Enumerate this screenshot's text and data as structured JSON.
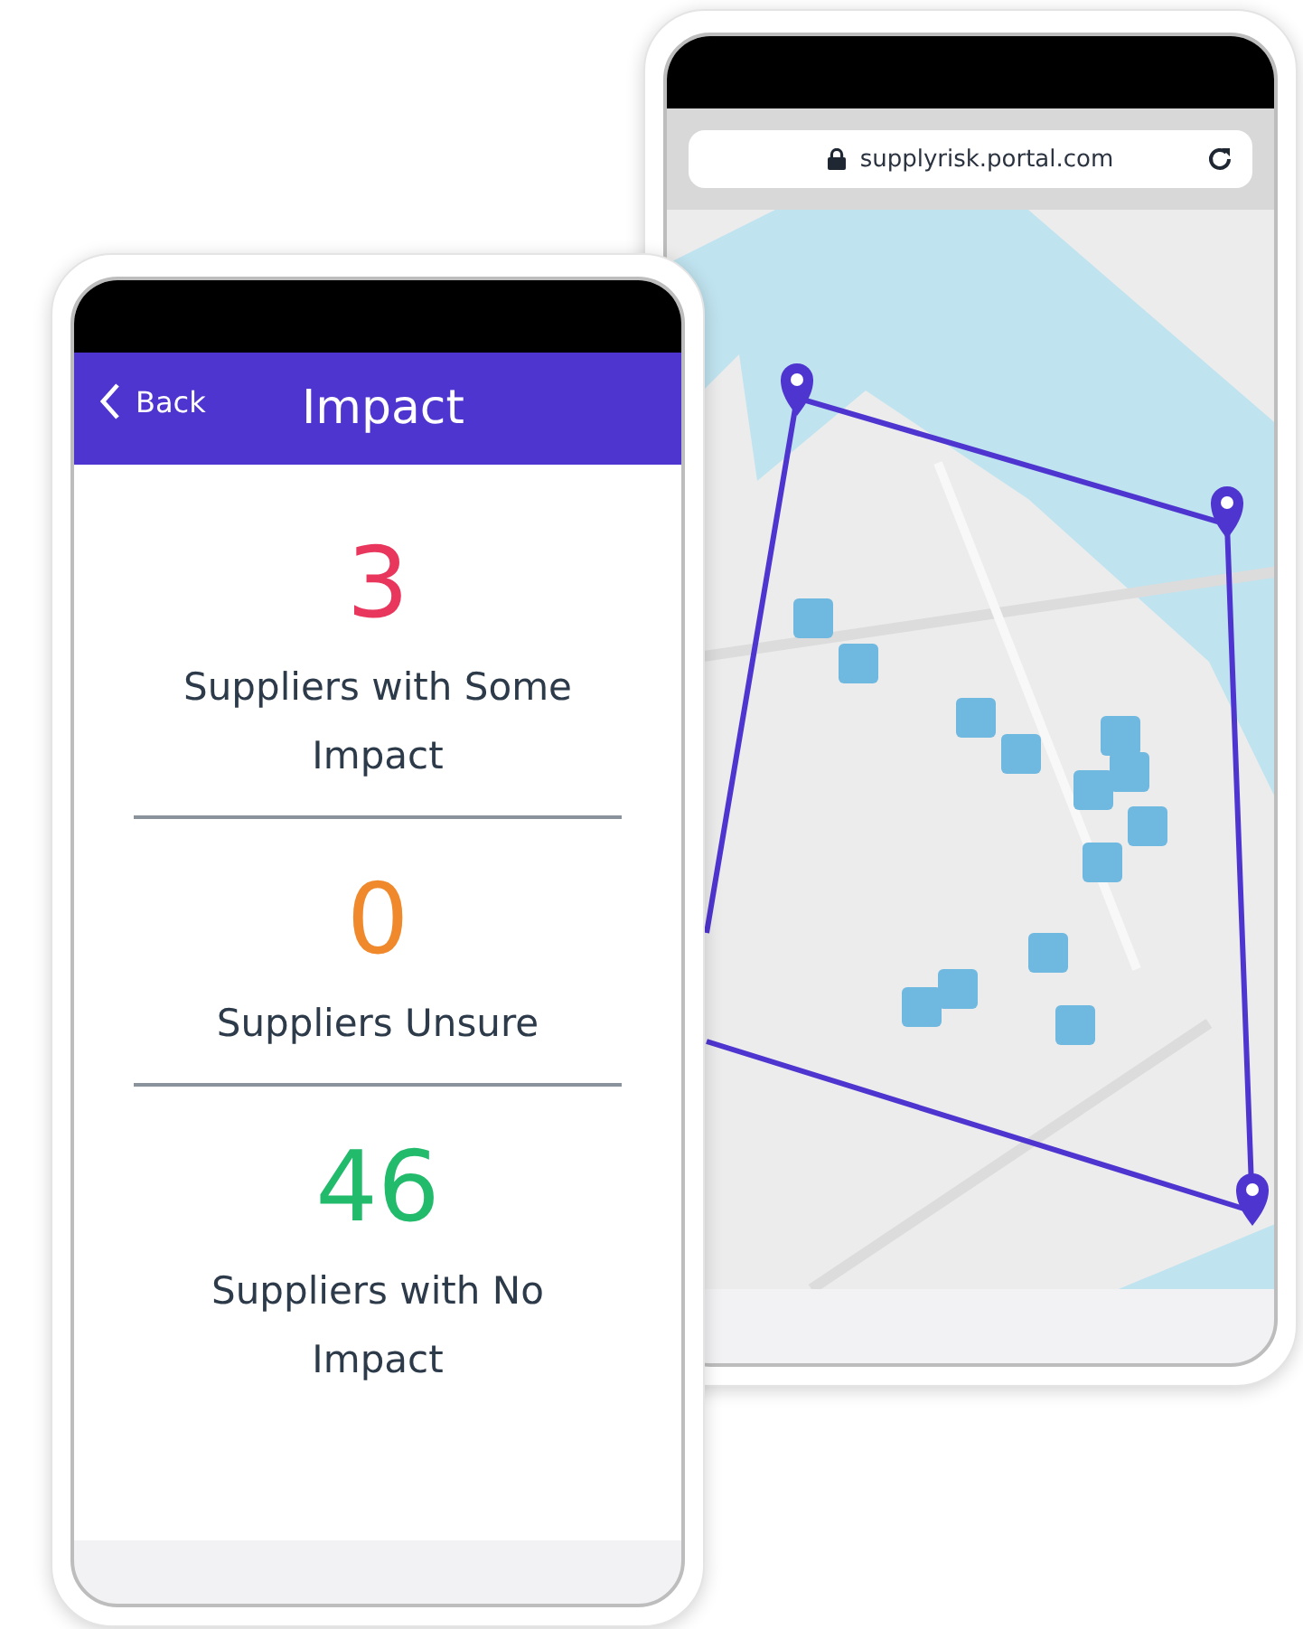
{
  "map_phone": {
    "address_bar": {
      "url": "supplyrisk.portal.com"
    }
  },
  "impact_phone": {
    "header": {
      "back_label": "Back",
      "title": "Impact"
    },
    "stats": [
      {
        "value": "3",
        "label": "Suppliers with Some Impact",
        "color": "#e8365c"
      },
      {
        "value": "0",
        "label": "Suppliers Unsure",
        "color": "#f0892c"
      },
      {
        "value": "46",
        "label": "Suppliers with No Impact",
        "color": "#22bb6c"
      }
    ]
  }
}
